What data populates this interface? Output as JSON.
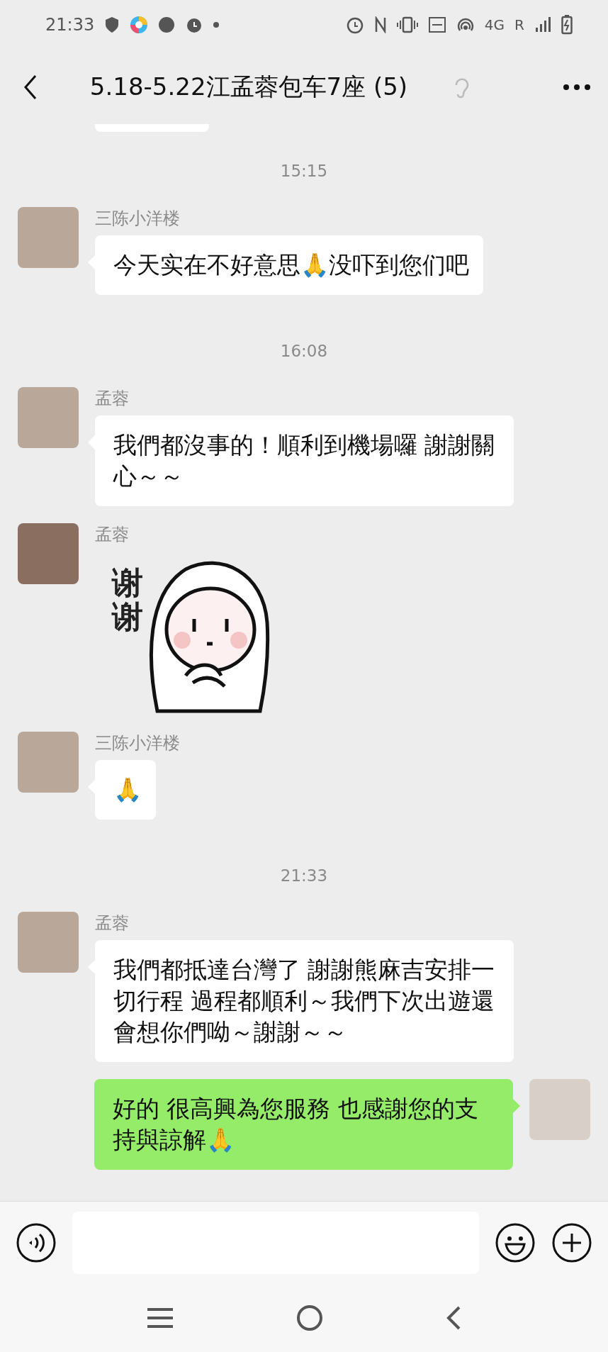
{
  "status_bar": {
    "time": "21:33",
    "network": "4G",
    "roaming": "R"
  },
  "header": {
    "title": "5.18-5.22江孟蓉包车7座 (5)"
  },
  "messages": [
    {
      "kind": "partial"
    },
    {
      "kind": "time",
      "text": "15:15"
    },
    {
      "kind": "text",
      "outgoing": false,
      "sender": "三陈小洋楼",
      "text": "今天实在不好意思🙏没吓到您们吧"
    },
    {
      "kind": "time",
      "text": "16:08"
    },
    {
      "kind": "text",
      "outgoing": false,
      "sender": "孟蓉",
      "text": "我們都沒事的！順利到機場囉 謝謝關心～～"
    },
    {
      "kind": "sticker",
      "sender": "孟蓉",
      "text": "谢谢"
    },
    {
      "kind": "text",
      "outgoing": false,
      "sender": "三陈小洋楼",
      "text": "🙏"
    },
    {
      "kind": "time",
      "text": "21:33"
    },
    {
      "kind": "text",
      "outgoing": false,
      "sender": "孟蓉",
      "text": "我們都抵達台灣了 謝謝熊麻吉安排一切行程 過程都順利～我們下次出遊還會想你們呦～謝謝～～"
    },
    {
      "kind": "text",
      "outgoing": true,
      "text": "好的 很高興為您服務 也感謝您的支持與諒解🙏"
    }
  ]
}
